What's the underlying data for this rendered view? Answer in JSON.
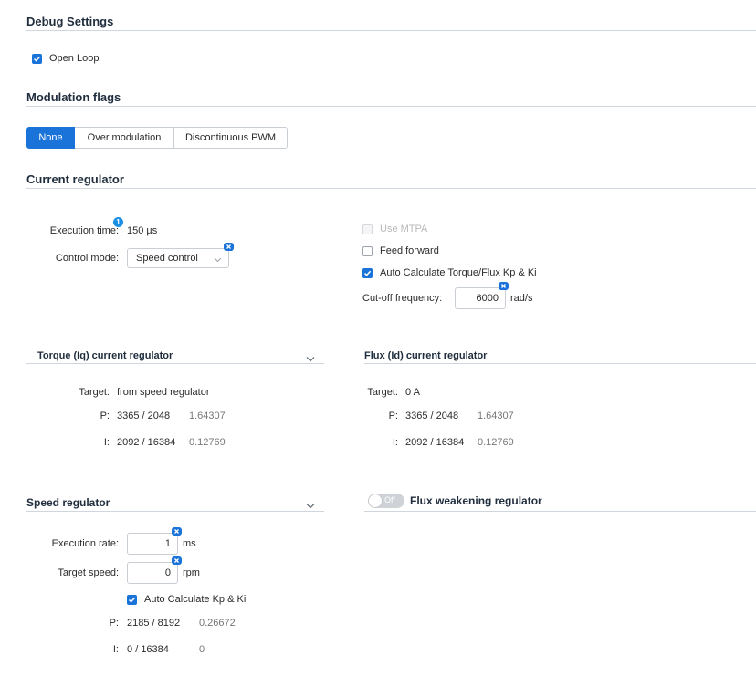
{
  "debug": {
    "title": "Debug Settings",
    "open_loop_label": "Open Loop",
    "open_loop_checked": true
  },
  "modulation": {
    "title": "Modulation flags",
    "options": [
      "None",
      "Over modulation",
      "Discontinuous PWM"
    ],
    "selected": "None"
  },
  "current_regulator": {
    "title": "Current regulator",
    "execution_time_label": "Execution time:",
    "execution_time_info": "1",
    "execution_time_value": "150 µs",
    "control_mode_label": "Control mode:",
    "control_mode_value": "Speed control",
    "use_mtpa_label": "Use MTPA",
    "use_mtpa_checked": false,
    "use_mtpa_disabled": true,
    "feed_forward_label": "Feed forward",
    "feed_forward_checked": false,
    "auto_calc_label": "Auto Calculate Torque/Flux Kp & Ki",
    "auto_calc_checked": true,
    "cutoff_label": "Cut-off frequency:",
    "cutoff_value": "6000",
    "cutoff_unit": "rad/s"
  },
  "torque_regulator": {
    "title": "Torque (Iq) current regulator",
    "target_label": "Target:",
    "target_value": "from speed regulator",
    "p_label": "P:",
    "p_num": "3365",
    "p_den": "2048",
    "p_value": "1.64307",
    "i_label": "I:",
    "i_num": "2092",
    "i_den": "16384",
    "i_value": "0.12769"
  },
  "flux_regulator": {
    "title": "Flux (Id) current regulator",
    "target_label": "Target:",
    "target_value": "0 A",
    "p_label": "P:",
    "p_num": "3365",
    "p_den": "2048",
    "p_value": "1.64307",
    "i_label": "I:",
    "i_num": "2092",
    "i_den": "16384",
    "i_value": "0.12769"
  },
  "speed_regulator": {
    "title": "Speed regulator",
    "execution_rate_label": "Execution rate:",
    "execution_rate_value": "1",
    "execution_rate_unit": "ms",
    "target_speed_label": "Target speed:",
    "target_speed_value": "0",
    "target_speed_unit": "rpm",
    "auto_calc_label": "Auto Calculate Kp & Ki",
    "auto_calc_checked": true,
    "p_label": "P:",
    "p_num": "2185",
    "p_den": "8192",
    "p_value": "0.26672",
    "i_label": "I:",
    "i_num": "0",
    "i_den": "16384",
    "i_value": "0"
  },
  "flux_weakening": {
    "title": "Flux weakening regulator",
    "toggle_label": "Off",
    "enabled": false
  },
  "colors": {
    "accent": "#1a73d9",
    "heading": "#1f2d3d",
    "divider": "#cfd6de"
  },
  "icons": {
    "check": "check-icon",
    "reset": "reset-x-icon",
    "chevron": "chevron-down-icon",
    "info": "info-badge-icon"
  }
}
